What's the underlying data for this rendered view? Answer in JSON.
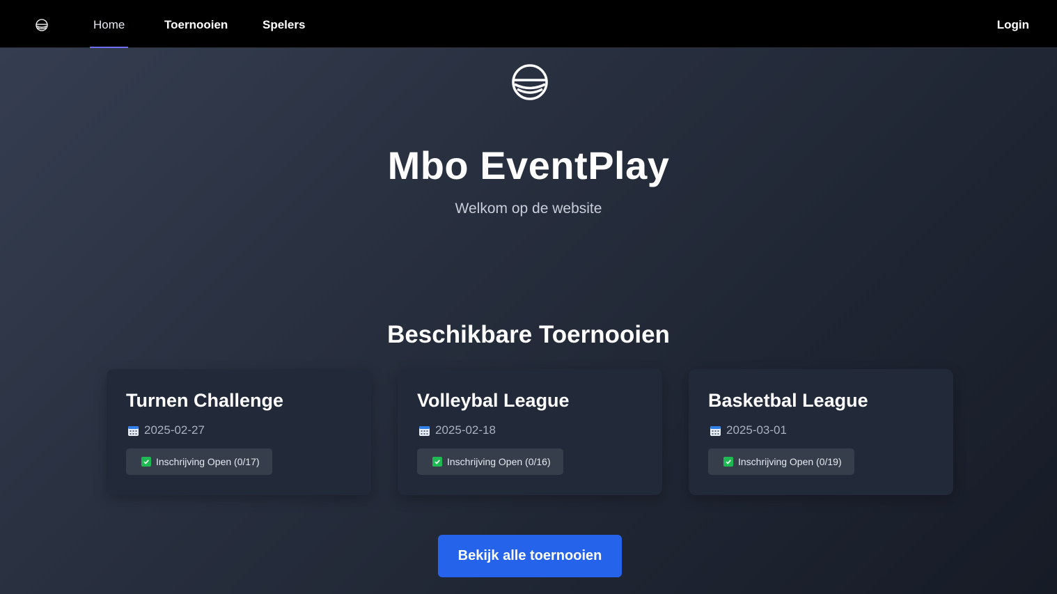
{
  "nav": {
    "logo_icon": "ball-logo-icon",
    "links": [
      {
        "label": "Home",
        "active": true
      },
      {
        "label": "Toernooien",
        "active": false
      },
      {
        "label": "Spelers",
        "active": false
      }
    ],
    "login_label": "Login",
    "active_underline_color": "#6d6ff0"
  },
  "hero": {
    "logo_icon": "ball-logo-icon",
    "title": "Mbo EventPlay",
    "subtitle": "Welkom op de website"
  },
  "tournaments_section": {
    "title": "Beschikbare Toernooien",
    "cards": [
      {
        "title": "Turnen Challenge",
        "date_icon": "calendar-icon",
        "date": "2025-02-27",
        "status_icon": "check-icon",
        "status": "Inschrijving Open (0/17)"
      },
      {
        "title": "Volleybal League",
        "date_icon": "calendar-icon",
        "date": "2025-02-18",
        "status_icon": "check-icon",
        "status": "Inschrijving Open (0/16)"
      },
      {
        "title": "Basketbal League",
        "date_icon": "calendar-icon",
        "date": "2025-03-01",
        "status_icon": "check-icon",
        "status": "Inschrijving Open (0/19)"
      }
    ]
  },
  "cta": {
    "label": "Bekijk alle toernooien",
    "color": "#2563eb"
  },
  "colors": {
    "nav_background": "#000000",
    "card_background": "#222938",
    "badge_background": "#363e4c",
    "check_green": "#1fb954"
  }
}
